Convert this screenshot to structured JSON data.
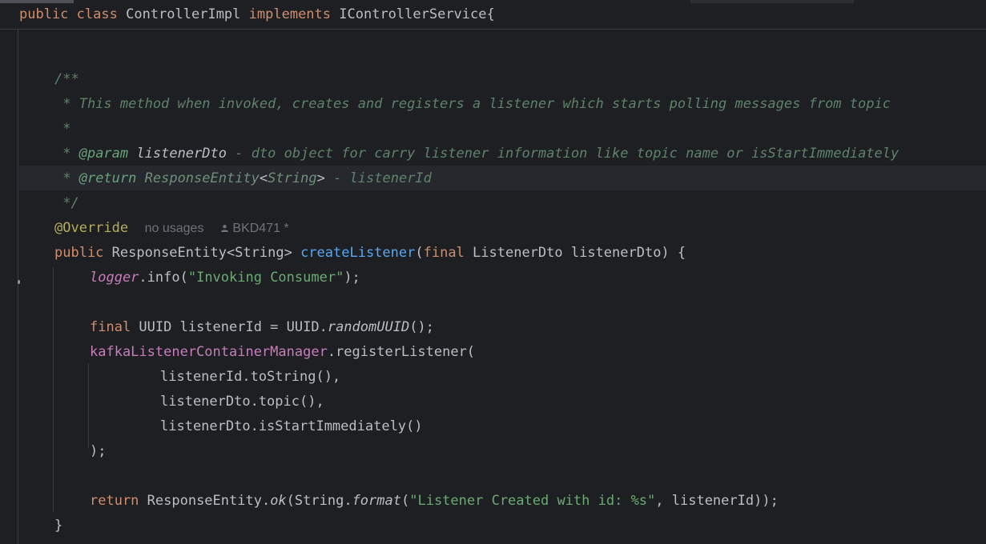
{
  "header": {
    "kw_public": "public",
    "kw_class": "class",
    "class_name": "ControllerImpl",
    "kw_implements": "implements",
    "interface": "IControllerService{"
  },
  "javadoc": {
    "open": "/**",
    "line1": " * This method when invoked, creates and registers a listener which starts polling messages from topic",
    "line2": " *",
    "line3_prefix": " * ",
    "line3_tag": "@param",
    "line3_name": "listenerDto",
    "line3_desc": " - dto object for carry listener information like topic name or isStartImmediately",
    "line4_prefix": " * ",
    "line4_tag": "@return",
    "line4_type": "ResponseEntity",
    "line4_lt": "<",
    "line4_generic": "String",
    "line4_gt": ">",
    "line4_desc": " - listenerId",
    "close": " */"
  },
  "annotation": {
    "name": "@Override",
    "usages": "no usages",
    "author": "BKD471 *"
  },
  "method_sig": {
    "kw_public": "public",
    "ret": " ResponseEntity<String> ",
    "name": "createListener",
    "open": "(",
    "kw_final": "final",
    "params": " ListenerDto listenerDto) {"
  },
  "body": {
    "logger": "logger",
    "info_call": ".info(",
    "info_str": "\"Invoking Consumer\"",
    "info_end": ");",
    "kw_final": "final",
    "uuid_decl": " UUID listenerId = UUID.",
    "random": "randomUUID",
    "uuid_end": "();",
    "manager": "kafkaListenerContainerManager",
    "register": ".registerListener(",
    "arg1": "listenerId.toString(),",
    "arg2": "listenerDto.topic(),",
    "arg3": "listenerDto.isStartImmediately()",
    "close_call": ");",
    "kw_return": "return",
    "ret_mid": " ResponseEntity.",
    "ok": "ok",
    "ret_str_pre": "(String.",
    "format": "format",
    "ret_paren": "(",
    "ret_str": "\"Listener Created with id: %s\"",
    "ret_end": ", listenerId));",
    "brace": "}"
  }
}
